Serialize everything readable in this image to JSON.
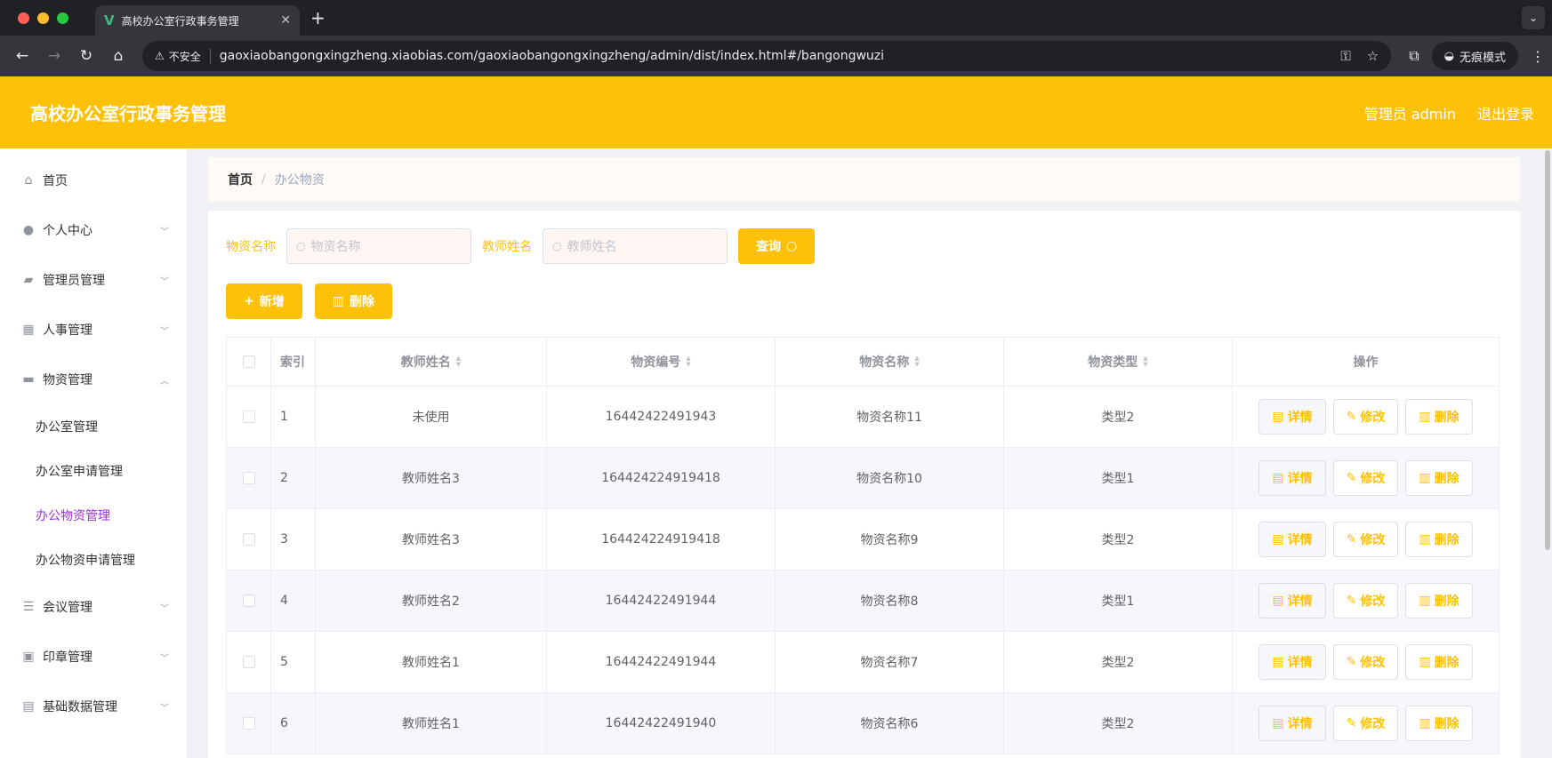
{
  "browser": {
    "tab_title": "高校办公室行政事务管理",
    "insecure_label": "不安全",
    "url": "gaoxiaobangongxingzheng.xiaobias.com/gaoxiaobangongxingzheng/admin/dist/index.html#/bangongwuzi",
    "incognito_label": "无痕模式"
  },
  "header": {
    "title": "高校办公室行政事务管理",
    "user": "管理员 admin",
    "logout": "退出登录"
  },
  "sidebar": {
    "items": [
      {
        "label": "首页",
        "icon": "home-icon"
      },
      {
        "label": "个人中心",
        "icon": "user-icon"
      },
      {
        "label": "管理员管理",
        "icon": "ticket-icon"
      },
      {
        "label": "人事管理",
        "icon": "grid-icon"
      },
      {
        "label": "物资管理",
        "icon": "chat-icon"
      },
      {
        "label": "会议管理",
        "icon": "list-icon"
      },
      {
        "label": "印章管理",
        "icon": "stamp-icon"
      },
      {
        "label": "基础数据管理",
        "icon": "clipboard-icon"
      }
    ],
    "sub_items": [
      "办公室管理",
      "办公室申请管理",
      "办公物资管理",
      "办公物资申请管理"
    ]
  },
  "breadcrumb": {
    "home": "首页",
    "current": "办公物资"
  },
  "search": {
    "name_label": "物资名称",
    "name_placeholder": "物资名称",
    "teacher_label": "教师姓名",
    "teacher_placeholder": "教师姓名",
    "query_button": "查询"
  },
  "actions": {
    "add": "新增",
    "delete": "删除"
  },
  "table": {
    "headers": {
      "index": "索引",
      "teacher": "教师姓名",
      "code": "物资编号",
      "name": "物资名称",
      "type": "物资类型",
      "ops": "操作"
    },
    "op_labels": {
      "detail": "详情",
      "edit": "修改",
      "delete": "删除"
    },
    "rows": [
      {
        "index": "1",
        "teacher": "未使用",
        "code": "16442422491943",
        "name": "物资名称11",
        "type": "类型2"
      },
      {
        "index": "2",
        "teacher": "教师姓名3",
        "code": "164424224919418",
        "name": "物资名称10",
        "type": "类型1"
      },
      {
        "index": "3",
        "teacher": "教师姓名3",
        "code": "164424224919418",
        "name": "物资名称9",
        "type": "类型2"
      },
      {
        "index": "4",
        "teacher": "教师姓名2",
        "code": "16442422491944",
        "name": "物资名称8",
        "type": "类型1"
      },
      {
        "index": "5",
        "teacher": "教师姓名1",
        "code": "16442422491944",
        "name": "物资名称7",
        "type": "类型2"
      },
      {
        "index": "6",
        "teacher": "教师姓名1",
        "code": "16442422491940",
        "name": "物资名称6",
        "type": "类型2"
      }
    ]
  },
  "colors": {
    "accent": "#ffc107",
    "active_sub": "#9b30d9"
  }
}
